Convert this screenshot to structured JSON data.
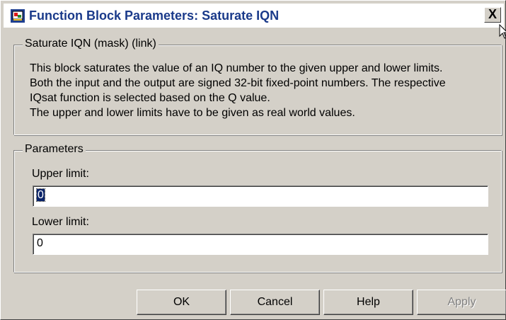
{
  "window": {
    "title": "Function Block Parameters: Saturate IQN",
    "close_glyph": "✕",
    "close_label": "X"
  },
  "description": {
    "group_label": "Saturate IQN (mask) (link)",
    "lines": [
      "This block saturates the value of an IQ number to the given upper and lower limits.",
      "Both the input and the output are signed 32-bit fixed-point numbers. The respective",
      "IQsat function is selected based on the Q value.",
      "The upper and lower limits have to be given as real world values."
    ]
  },
  "parameters": {
    "group_label": "Parameters",
    "upper_limit": {
      "label": "Upper limit:",
      "value": "0"
    },
    "lower_limit": {
      "label": "Lower limit:",
      "value": "0"
    }
  },
  "buttons": {
    "ok": "OK",
    "cancel": "Cancel",
    "help": "Help",
    "apply": "Apply"
  },
  "icons": {
    "app": "simulink-block-icon",
    "close": "close-icon",
    "cursor": "mouse-pointer-icon"
  }
}
